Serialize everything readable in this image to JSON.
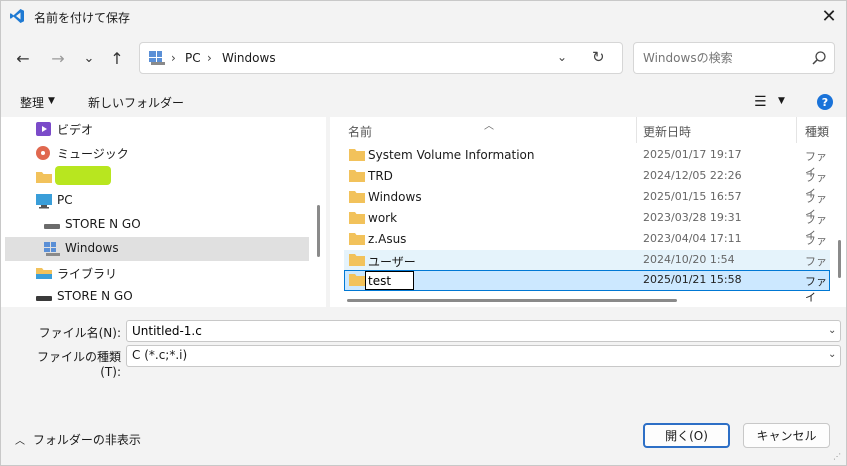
{
  "window": {
    "title": "名前を付けて保存"
  },
  "nav": {
    "back": "←",
    "forward": "→",
    "recent": "⌄",
    "up": "↑"
  },
  "address": {
    "segments": [
      "PC",
      "Windows"
    ],
    "separator": "›",
    "dropdown": "⌄",
    "refresh": "↻"
  },
  "search": {
    "placeholder": "Windowsの検索"
  },
  "command_bar": {
    "organize": "整理",
    "new_folder": "新しいフォルダー",
    "help": "?"
  },
  "nav_pane": {
    "items": [
      {
        "label": "ビデオ",
        "icon": "video-icon"
      },
      {
        "label": "ミュージック",
        "icon": "music-icon"
      },
      {
        "label": "",
        "icon": "folder-icon"
      },
      {
        "label": "PC",
        "icon": "pc-icon"
      },
      {
        "label": "STORE N GO",
        "icon": "drive-icon"
      },
      {
        "label": "Windows",
        "icon": "windows-drive-icon"
      },
      {
        "label": "ライブラリ",
        "icon": "library-icon"
      },
      {
        "label": "STORE N GO",
        "icon": "drive-icon"
      }
    ]
  },
  "file_list": {
    "columns": [
      "名前",
      "更新日時",
      "種類"
    ],
    "rows": [
      {
        "name": "System Volume Information",
        "date": "2025/01/17 19:17",
        "type": "ファイ"
      },
      {
        "name": "TRD",
        "date": "2024/12/05 22:26",
        "type": "ファイ"
      },
      {
        "name": "Windows",
        "date": "2025/01/15 16:57",
        "type": "ファイ"
      },
      {
        "name": "work",
        "date": "2023/03/28 19:31",
        "type": "ファイ"
      },
      {
        "name": "z.Asus",
        "date": "2023/04/04 17:11",
        "type": "ファイ"
      },
      {
        "name": "ユーザー",
        "date": "2024/10/20 1:54",
        "type": "ファイ"
      }
    ],
    "editing_row": {
      "name": "test",
      "date": "2025/01/21 15:58",
      "type": "ファイ"
    }
  },
  "form": {
    "filename_label": "ファイル名(N):",
    "filename_value": "Untitled-1.c",
    "filetype_label": "ファイルの種類(T):",
    "filetype_value": "C (*.c;*.i)"
  },
  "footer": {
    "hide_folders": "フォルダーの非表示",
    "open": "開く(O)",
    "cancel": "キャンセル"
  },
  "colors": {
    "accent": "#0078d4",
    "selection": "#cce8ff",
    "hover": "#e5f3fb",
    "folder": "#f2c25b",
    "highlight_marker": "#b8e61f"
  }
}
